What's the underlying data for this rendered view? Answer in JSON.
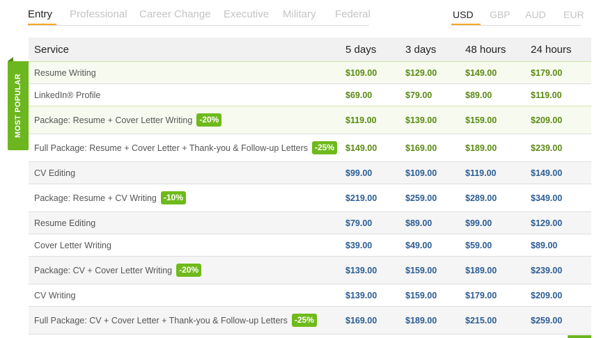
{
  "tabs": [
    {
      "label": "Entry",
      "active": true
    },
    {
      "label": "Professional",
      "active": false
    },
    {
      "label": "Career Change",
      "active": false
    },
    {
      "label": "Executive",
      "active": false
    },
    {
      "label": "Military",
      "active": false
    },
    {
      "label": "Federal",
      "active": false
    }
  ],
  "currencies": [
    {
      "label": "USD",
      "active": true
    },
    {
      "label": "GBP",
      "active": false
    },
    {
      "label": "AUD",
      "active": false
    },
    {
      "label": "EUR",
      "active": false
    }
  ],
  "table": {
    "headers": {
      "service": "Service",
      "d5": "5 days",
      "d3": "3 days",
      "h48": "48 hours",
      "h24": "24 hours"
    },
    "ribbon_label": "MOST POPULAR",
    "rows": [
      {
        "service": "Resume Writing",
        "badge": "",
        "prices": [
          "$109.00",
          "$129.00",
          "$149.00",
          "$179.00"
        ]
      },
      {
        "service": "LinkedIn® Profile",
        "badge": "",
        "prices": [
          "$69.00",
          "$79.00",
          "$89.00",
          "$119.00"
        ]
      },
      {
        "service": "Package: Resume + Cover Letter Writing",
        "badge": "-20%",
        "prices": [
          "$119.00",
          "$139.00",
          "$159.00",
          "$209.00"
        ]
      },
      {
        "service": "Full Package: Resume + Cover Letter + Thank-you & Follow-up Letters",
        "badge": "-25%",
        "prices": [
          "$149.00",
          "$169.00",
          "$189.00",
          "$239.00"
        ]
      },
      {
        "service": "CV Editing",
        "badge": "",
        "prices": [
          "$99.00",
          "$109.00",
          "$119.00",
          "$149.00"
        ]
      },
      {
        "service": "Package: Resume + CV Writing",
        "badge": "-10%",
        "prices": [
          "$219.00",
          "$259.00",
          "$289.00",
          "$349.00"
        ]
      },
      {
        "service": "Resume Editing",
        "badge": "",
        "prices": [
          "$79.00",
          "$89.00",
          "$99.00",
          "$129.00"
        ]
      },
      {
        "service": "Cover Letter Writing",
        "badge": "",
        "prices": [
          "$39.00",
          "$49.00",
          "$59.00",
          "$89.00"
        ]
      },
      {
        "service": "Package: CV + Cover Letter Writing",
        "badge": "-20%",
        "prices": [
          "$139.00",
          "$159.00",
          "$189.00",
          "$239.00"
        ]
      },
      {
        "service": "CV Writing",
        "badge": "",
        "prices": [
          "$139.00",
          "$159.00",
          "$179.00",
          "$209.00"
        ]
      },
      {
        "service": "Full Package: CV + Cover Letter + Thank-you & Follow-up Letters",
        "badge": "-25%",
        "prices": [
          "$169.00",
          "$189.00",
          "$215.00",
          "$259.00"
        ]
      }
    ]
  },
  "colors": {
    "accent": "#f5a623",
    "popular_green": "#6cb61f",
    "price_green": "#5a8a14",
    "price_blue": "#2c5d94"
  }
}
